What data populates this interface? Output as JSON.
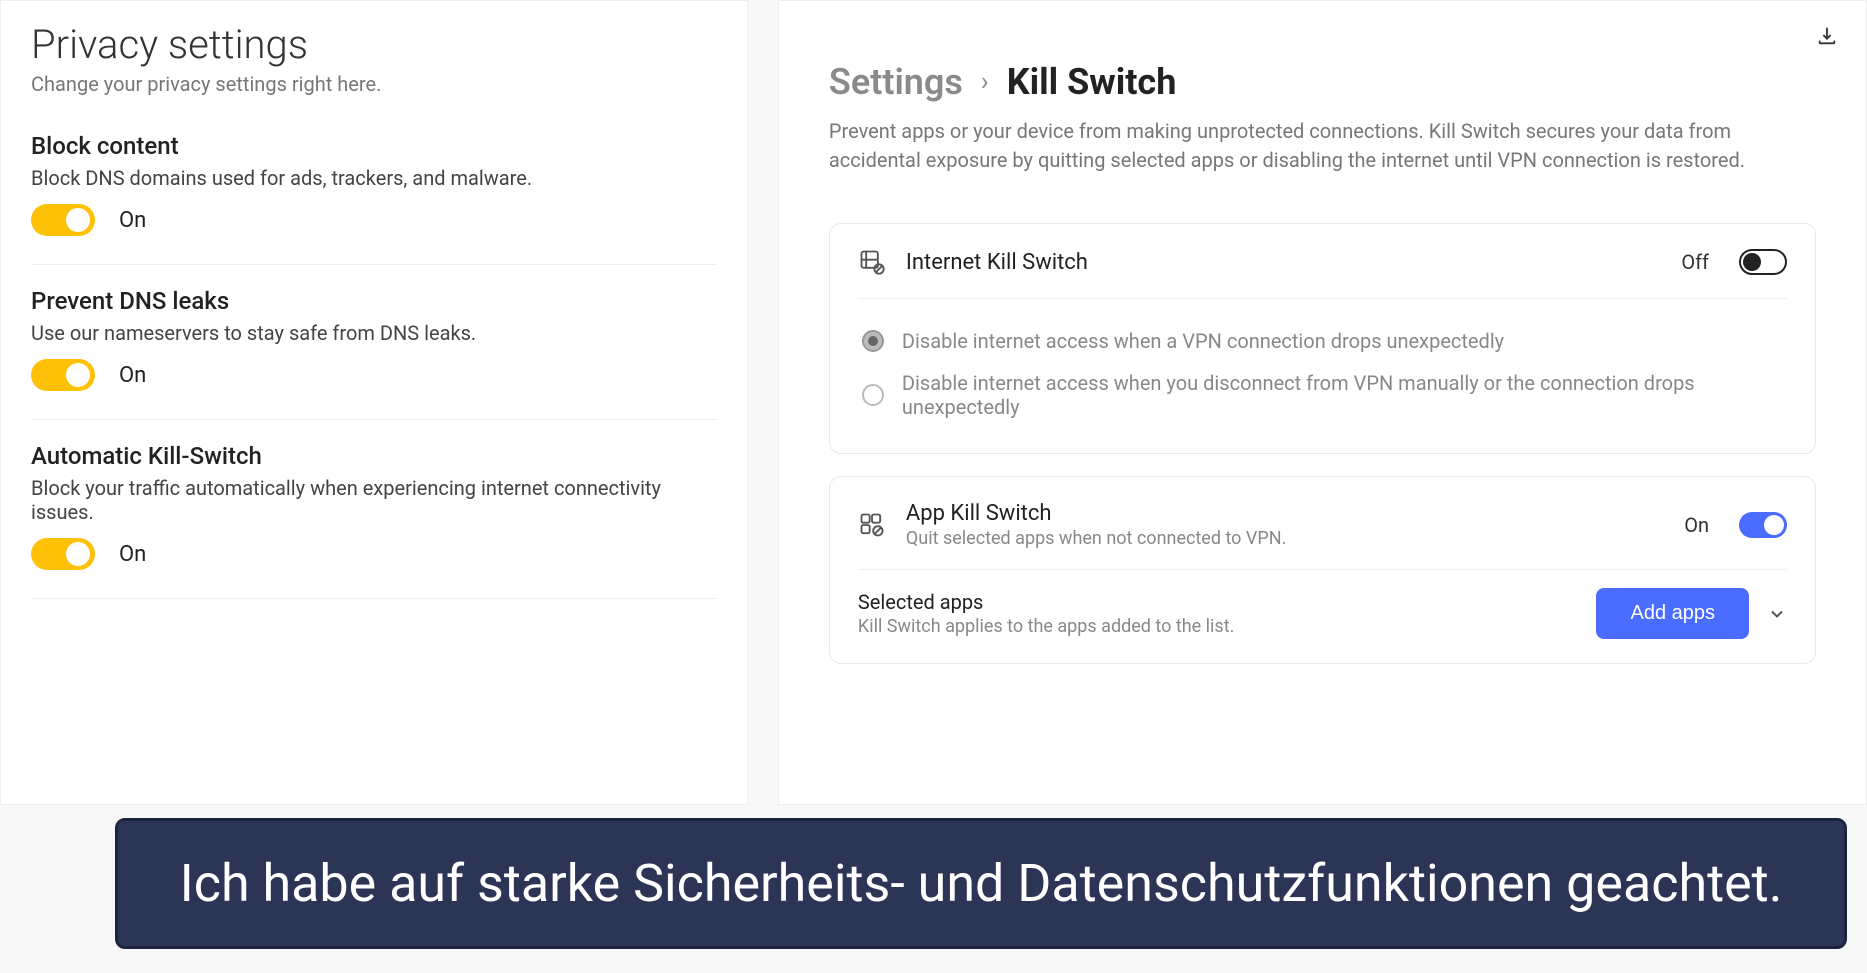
{
  "left": {
    "title": "Privacy settings",
    "subtitle": "Change your privacy settings right here.",
    "items": [
      {
        "title": "Block content",
        "desc": "Block DNS domains used for ads, trackers, and malware.",
        "state": "On"
      },
      {
        "title": "Prevent DNS leaks",
        "desc": "Use our nameservers to stay safe from DNS leaks.",
        "state": "On"
      },
      {
        "title": "Automatic Kill-Switch",
        "desc": "Block your traffic automatically when experiencing internet connectivity issues.",
        "state": "On"
      }
    ]
  },
  "right": {
    "breadcrumb": {
      "settings": "Settings",
      "page": "Kill Switch"
    },
    "desc": "Prevent apps or your device from making unprotected connections. Kill Switch secures your data from accidental exposure by quitting selected apps or disabling the internet until VPN connection is restored.",
    "internet_ks": {
      "title": "Internet Kill Switch",
      "state": "Off",
      "options": [
        "Disable internet access when a VPN connection drops unexpectedly",
        "Disable internet access when you disconnect from VPN manually or the connection drops unexpectedly"
      ]
    },
    "app_ks": {
      "title": "App Kill Switch",
      "desc": "Quit selected apps when not connected to VPN.",
      "state": "On",
      "selected_apps": {
        "title": "Selected apps",
        "desc": "Kill Switch applies to the apps added to the list.",
        "button": "Add apps"
      }
    }
  },
  "banner": "Ich habe auf starke Sicherheits- und Datenschutzfunktionen geachtet."
}
